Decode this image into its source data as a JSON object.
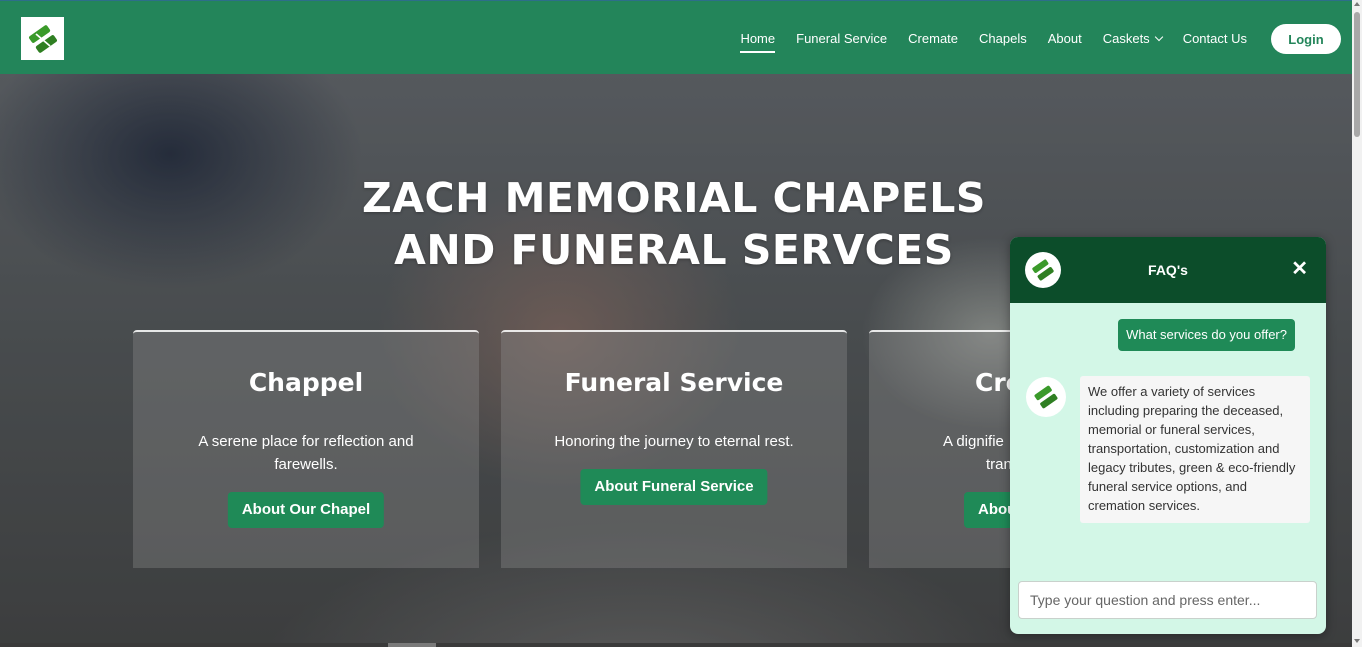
{
  "nav": {
    "logo": "logo-icon",
    "items": [
      {
        "label": "Home",
        "active": true
      },
      {
        "label": "Funeral Service"
      },
      {
        "label": "Cremate"
      },
      {
        "label": "Chapels"
      },
      {
        "label": "About"
      },
      {
        "label": "Caskets",
        "dropdown": true
      },
      {
        "label": "Contact Us"
      }
    ],
    "login_label": "Login"
  },
  "hero": {
    "title_line1": "ZACH MEMORIAL CHAPELS",
    "title_line2": "AND FUNERAL SERVCES"
  },
  "cards": [
    {
      "title": "Chappel",
      "desc": "A serene place for reflection and farewells.",
      "button": "About Our Chapel"
    },
    {
      "title": "Funeral Service",
      "desc": "Honoring the journey to eternal rest.",
      "button": "About Funeral Service"
    },
    {
      "title": "Cre",
      "desc": "A dignifie",
      "desc2": "tran",
      "button": "Abou"
    }
  ],
  "chat": {
    "title": "FAQ's",
    "close_icon": "close-icon",
    "user_message": "What services do you offer?",
    "bot_message": "We offer a variety of services including preparing the deceased, memorial or funeral services, transportation, customization and legacy tributes, green & eco-friendly funeral service options, and cremation services.",
    "input_placeholder": "Type your question and press enter..."
  },
  "colors": {
    "brand_green": "#23855a",
    "chat_header": "#0c4d2a",
    "chat_bg": "#d3f7e7",
    "button_green": "#1f8a57"
  }
}
